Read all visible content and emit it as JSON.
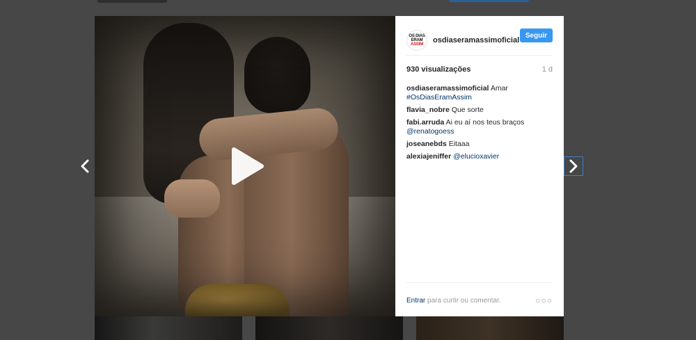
{
  "post": {
    "username": "osdiaseramassimoficial",
    "follow_label": "Seguir",
    "avatar_text": [
      "OS DIAS",
      "ERAM",
      "ASSIM"
    ],
    "views": "930 visualizações",
    "age": "1 d"
  },
  "comments": [
    {
      "user": "osdiaseramassimoficial",
      "text": "Amar",
      "link": "#OsDiasEramAssim"
    },
    {
      "user": "flavia_nobre",
      "text": "Que sorte",
      "link": ""
    },
    {
      "user": "fabi.arruda",
      "text": "Ai eu aí nos teus braços",
      "link": "@renatogoess"
    },
    {
      "user": "joseanebds",
      "text": "Eitaaa",
      "link": ""
    },
    {
      "user": "alexiajeniffer",
      "text": "",
      "link": "@elucioxavier"
    }
  ],
  "footer": {
    "login_label": "Entrar",
    "prompt": "para curtir ou comentar.",
    "more": "○○○"
  },
  "icons": {
    "prev": "chevron-left-icon",
    "next": "chevron-right-icon",
    "play": "play-icon"
  },
  "colors": {
    "background": "#474747",
    "follow_button": "#3897f0",
    "link": "#003569",
    "nav_focus": "#3f7ed0"
  }
}
